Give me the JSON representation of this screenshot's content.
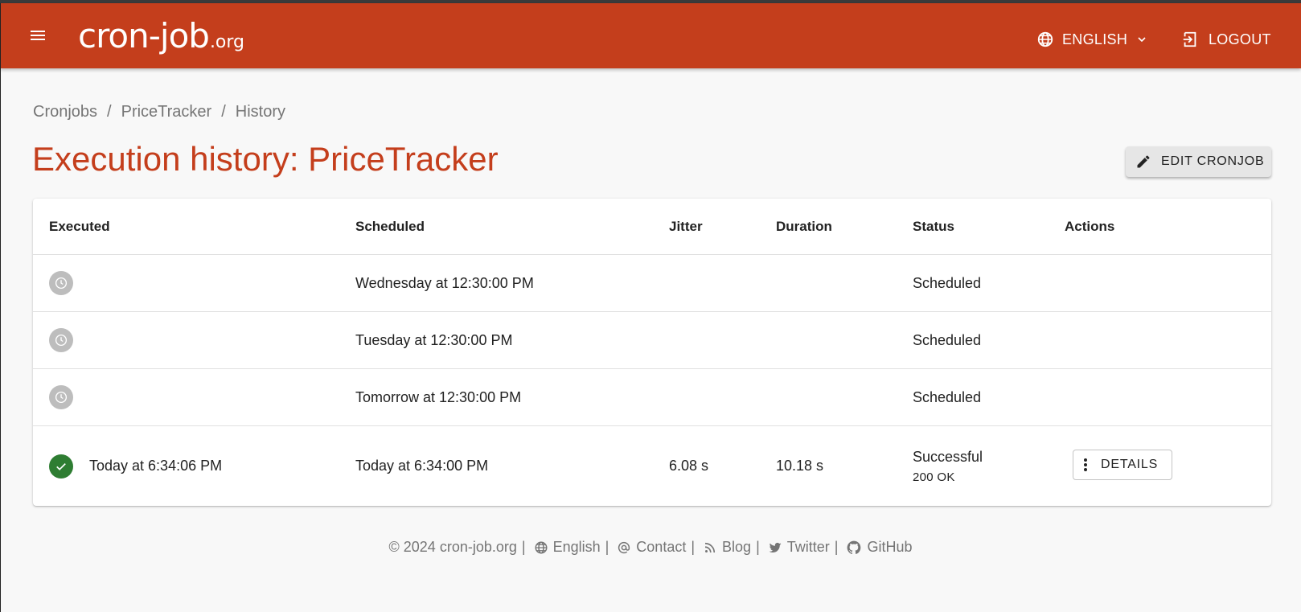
{
  "header": {
    "logo_main": "cron-job",
    "logo_tld": ".org",
    "language_label": "ENGLISH",
    "logout_label": "LOGOUT"
  },
  "breadcrumb": [
    "Cronjobs",
    "PriceTracker",
    "History"
  ],
  "page_title": "Execution history: PriceTracker",
  "edit_button_label": "EDIT CRONJOB",
  "table": {
    "columns": [
      "Executed",
      "Scheduled",
      "Jitter",
      "Duration",
      "Status",
      "Actions"
    ],
    "rows": [
      {
        "state": "scheduled",
        "executed": "",
        "scheduled": "Wednesday at 12:30:00 PM",
        "jitter": "",
        "duration": "",
        "status": "Scheduled",
        "status_detail": ""
      },
      {
        "state": "scheduled",
        "executed": "",
        "scheduled": "Tuesday at 12:30:00 PM",
        "jitter": "",
        "duration": "",
        "status": "Scheduled",
        "status_detail": ""
      },
      {
        "state": "scheduled",
        "executed": "",
        "scheduled": "Tomorrow at 12:30:00 PM",
        "jitter": "",
        "duration": "",
        "status": "Scheduled",
        "status_detail": ""
      },
      {
        "state": "successful",
        "executed": "Today at 6:34:06 PM",
        "scheduled": "Today at 6:34:00 PM",
        "jitter": "6.08 s",
        "duration": "10.18 s",
        "status": "Successful",
        "status_detail": "200 OK",
        "action_label": "DETAILS"
      }
    ]
  },
  "footer": {
    "copyright": "© 2024 cron-job.org",
    "links": [
      "English",
      "Contact",
      "Blog",
      "Twitter",
      "GitHub"
    ]
  },
  "colors": {
    "brand": "#c43e1c",
    "success": "#2e7d32",
    "pending": "#bdbdbd"
  },
  "icons": [
    "menu-icon",
    "globe-icon",
    "chevron-down-icon",
    "logout-icon",
    "pencil-icon",
    "clock-icon",
    "check-icon",
    "more-vert-icon",
    "at-icon",
    "rss-icon",
    "twitter-icon",
    "github-icon"
  ]
}
